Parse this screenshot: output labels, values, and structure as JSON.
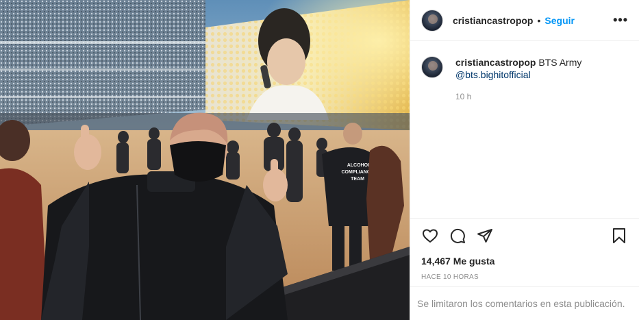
{
  "post": {
    "username": "cristiancastropop",
    "separator": "•",
    "follow_label": "Seguir",
    "more_label": "•••",
    "caption_username": "cristiancastropop",
    "caption_text": "BTS Army",
    "caption_mention": "@bts.bighitofficial",
    "caption_time": "10 h",
    "likes": "14,467 Me gusta",
    "posted_ago": "HACE 10 HORAS",
    "comments_disabled": "Se limitaron los comentarios en esta publicación."
  },
  "photo": {
    "jacket_text_1": "ALCOHOL",
    "jacket_text_2": "COMPLIANCE",
    "jacket_text_3": "TEAM"
  },
  "icons": {
    "like": "heart-icon",
    "comment": "comment-icon",
    "share": "paper-plane-icon",
    "save": "bookmark-icon",
    "more": "more-options-icon"
  },
  "colors": {
    "link_blue": "#0095f6",
    "mention": "#00376b",
    "text": "#262626",
    "muted": "#8e8e8e",
    "border": "#efefef"
  }
}
